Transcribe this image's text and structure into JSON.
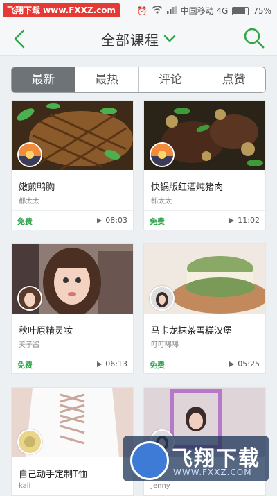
{
  "watermark_top": "飞翔下载 www.FXXZ.com",
  "status": {
    "carrier": "中国移动 4G",
    "battery": "75%"
  },
  "header": {
    "title": "全部课程"
  },
  "tabs": [
    {
      "label": "最新",
      "active": true
    },
    {
      "label": "最热",
      "active": false
    },
    {
      "label": "评论",
      "active": false
    },
    {
      "label": "点赞",
      "active": false
    }
  ],
  "courses": [
    {
      "title": "嫩煎鸭胸",
      "author": "都太太",
      "price": "免费",
      "duration": "08:03"
    },
    {
      "title": "快锅版红酒炖猪肉",
      "author": "都太太",
      "price": "免费",
      "duration": "11:02"
    },
    {
      "title": "秋叶原精灵妆",
      "author": "美子酱",
      "price": "免费",
      "duration": "06:13"
    },
    {
      "title": "马卡龙抹茶雪糕汉堡",
      "author": "叮叮嗥嗥",
      "price": "免费",
      "duration": "05:25"
    },
    {
      "title": "自己动手定制T恤",
      "author": "kali",
      "price": "",
      "duration": ""
    },
    {
      "title": "",
      "author": "Jenny",
      "price": "",
      "duration": ""
    }
  ],
  "watermark_bottom": {
    "big": "飞翔下载",
    "small": "WWW.FXXZ.COM"
  },
  "colors": {
    "accent": "#2fa64a",
    "tab_active": "#6d7377"
  }
}
